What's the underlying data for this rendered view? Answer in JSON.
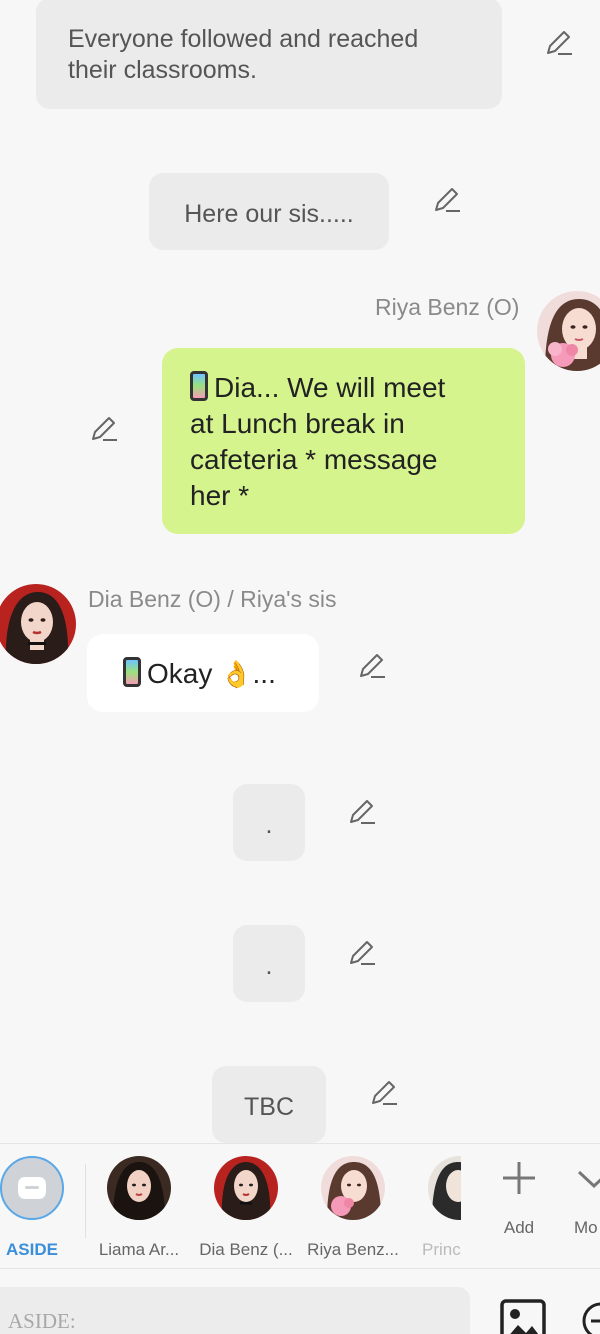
{
  "messages": [
    {
      "type": "narration",
      "text_line1": "Everyone followed and reached",
      "text_line2": "their classrooms."
    },
    {
      "type": "narration",
      "text": "Here our sis....."
    },
    {
      "type": "character",
      "name": "Riya Benz (O)",
      "text": "Dia... We will meet at Lunch break in cafeteria * message her *"
    },
    {
      "type": "character",
      "name": "Dia Benz (O) / Riya's sis",
      "text": "Okay",
      "suffix": "..."
    },
    {
      "type": "narration",
      "text": "."
    },
    {
      "type": "narration",
      "text": "."
    },
    {
      "type": "narration",
      "text": "TBC"
    }
  ],
  "green_lines": [
    "Dia... We will meet",
    "at Lunch break in",
    "cafeteria * message",
    "her *"
  ],
  "character_bar": {
    "items": [
      {
        "label": "ASIDE"
      },
      {
        "label": "Liama Ar..."
      },
      {
        "label": "Dia Benz (..."
      },
      {
        "label": "Riya Benz..."
      },
      {
        "label": "Princ"
      }
    ],
    "add_label": "Add",
    "more_label": "Mo"
  },
  "input": {
    "placeholder": "ASIDE:"
  },
  "icons": [
    "pencil-icon",
    "phone-icon",
    "ok-hand-icon",
    "aside-icon",
    "plus-icon",
    "chevron-down-icon",
    "image-icon",
    "minus-circle-icon"
  ],
  "colors": {
    "green_bubble": "#d6f48e",
    "narration_bubble": "#ebebeb",
    "accent": "#3b8fd9"
  }
}
